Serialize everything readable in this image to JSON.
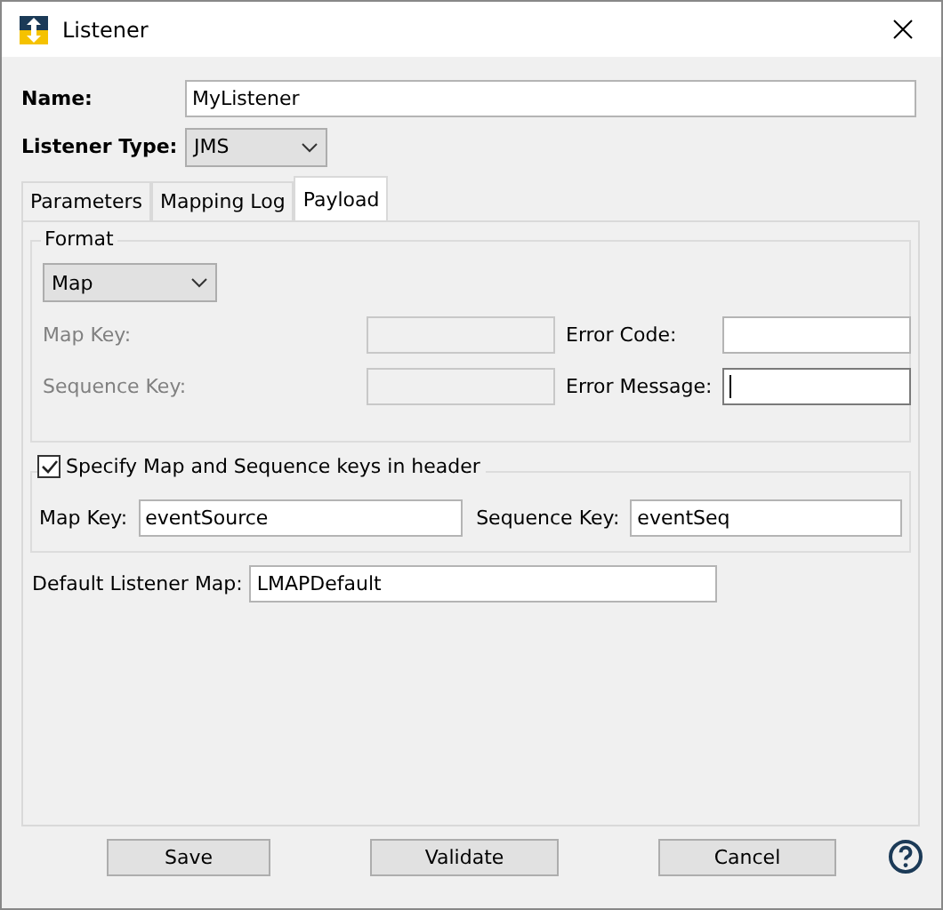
{
  "window": {
    "title": "Listener"
  },
  "name": {
    "label": "Name:",
    "value": "MyListener"
  },
  "listener_type": {
    "label": "Listener Type:",
    "value": "JMS"
  },
  "tabs": [
    {
      "label": "Parameters",
      "selected": false
    },
    {
      "label": "Mapping Log",
      "selected": false
    },
    {
      "label": "Payload",
      "selected": true
    }
  ],
  "format": {
    "title": "Format",
    "value": "Map",
    "fields": [
      {
        "label": "Map Key:",
        "disabled": true,
        "focused": false
      },
      {
        "label": "Error Code:",
        "disabled": false,
        "focused": false
      },
      {
        "label": "Sequence Key:",
        "disabled": true,
        "focused": false
      },
      {
        "label": "Error Message:",
        "disabled": false,
        "focused": true
      }
    ]
  },
  "header_keys": {
    "label": "Specify Map and Sequence keys in header",
    "checked": true,
    "fields": [
      {
        "label": "Map Key:",
        "value": "eventSource"
      },
      {
        "label": "Sequence Key:",
        "value": "eventSeq"
      }
    ]
  },
  "default_listener_map": {
    "label": "Default Listener Map:",
    "value": "LMAPDefault"
  },
  "buttons": [
    "Save",
    "Validate",
    "Cancel"
  ]
}
